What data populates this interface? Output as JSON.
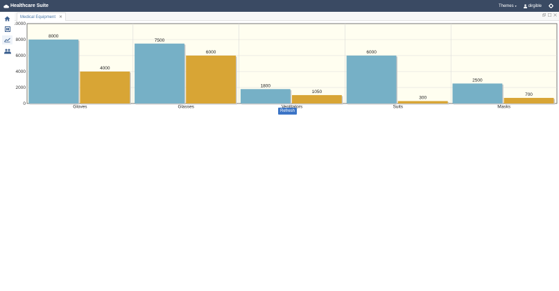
{
  "app": {
    "title": "Healthcare Suite"
  },
  "topbar": {
    "themes_label": "Themes",
    "user_label": "dirgible"
  },
  "sidebar": {
    "items": [
      "home",
      "hospital",
      "chart",
      "users"
    ]
  },
  "tabs": [
    {
      "label": "Medical Equipment"
    }
  ],
  "chart": {
    "refresh_label": "Refresh"
  },
  "colors": {
    "series1": "#76b0c6",
    "series2": "#d8a535",
    "topbar": "#3a4a63",
    "plot_bg": "#fffef0"
  },
  "chart_data": {
    "type": "bar",
    "categories": [
      "Gloves",
      "Glasses",
      "Ventilators",
      "Suits",
      "Masks"
    ],
    "series": [
      {
        "values": [
          8000,
          7500,
          1800,
          6000,
          2500
        ]
      },
      {
        "values": [
          4000,
          6000,
          1050,
          300,
          700
        ]
      }
    ],
    "ylim": [
      0,
      10000
    ],
    "yticks": [
      0,
      2000,
      4000,
      6000,
      8000,
      10000
    ],
    "grid": true
  }
}
